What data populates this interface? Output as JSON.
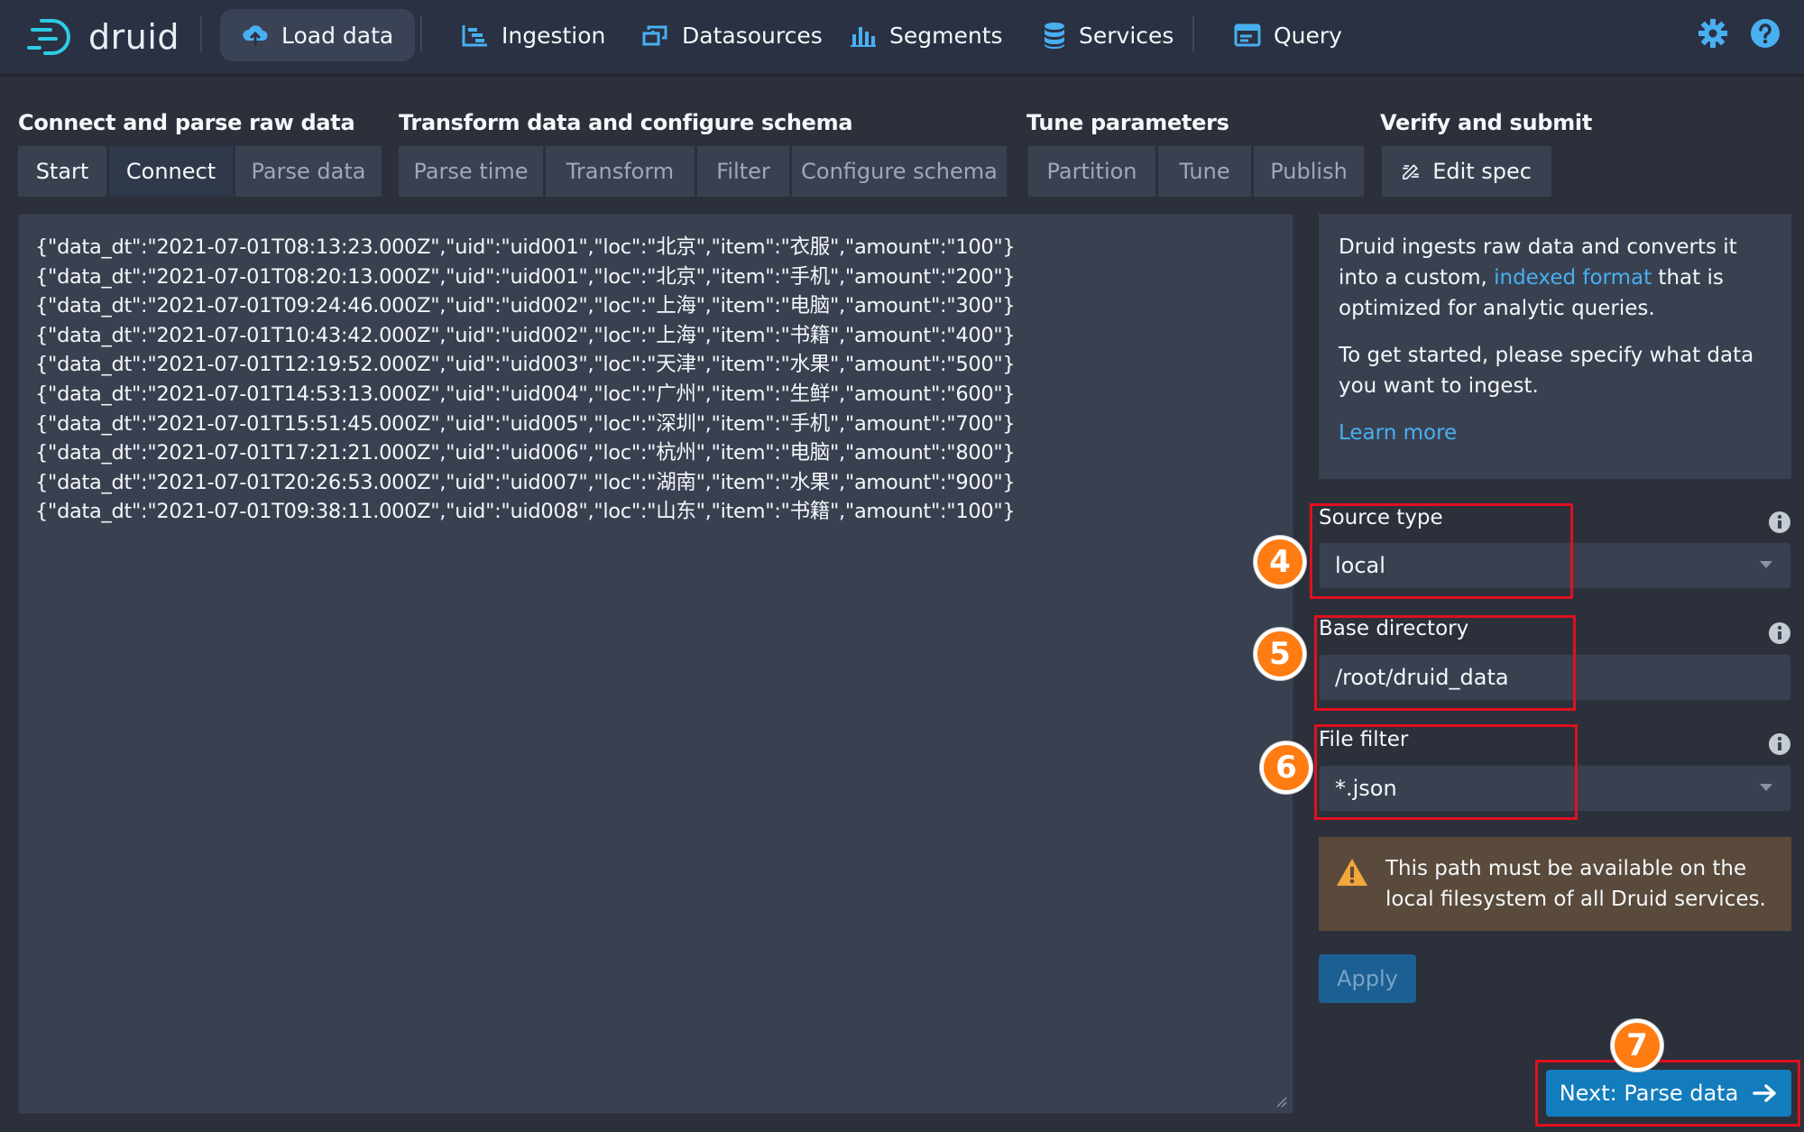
{
  "nav": {
    "logo_text": "druid",
    "items": [
      {
        "label": "Load data",
        "icon": "cloud-upload-icon"
      },
      {
        "label": "Ingestion",
        "icon": "gantt-chart-icon"
      },
      {
        "label": "Datasources",
        "icon": "multi-select-icon"
      },
      {
        "label": "Segments",
        "icon": "stacked-chart-icon"
      },
      {
        "label": "Services",
        "icon": "database-icon"
      },
      {
        "label": "Query",
        "icon": "application-icon"
      }
    ],
    "right_icons": [
      "gear-icon",
      "help-icon"
    ],
    "accent": "#48aff0"
  },
  "steps": {
    "connect_header": "Connect and parse raw data",
    "transform_header": "Transform data and configure schema",
    "tune_header": "Tune parameters",
    "verify_header": "Verify and submit",
    "start": "Start",
    "connect": "Connect",
    "parse_data": "Parse data",
    "parse_time": "Parse time",
    "transform": "Transform",
    "filter": "Filter",
    "configure_schema": "Configure schema",
    "partition": "Partition",
    "tune": "Tune",
    "publish": "Publish",
    "edit_spec": "Edit spec"
  },
  "raw_data": [
    "{\"data_dt\":\"2021-07-01T08:13:23.000Z\",\"uid\":\"uid001\",\"loc\":\"北京\",\"item\":\"衣服\",\"amount\":\"100\"}",
    "{\"data_dt\":\"2021-07-01T08:20:13.000Z\",\"uid\":\"uid001\",\"loc\":\"北京\",\"item\":\"手机\",\"amount\":\"200\"}",
    "{\"data_dt\":\"2021-07-01T09:24:46.000Z\",\"uid\":\"uid002\",\"loc\":\"上海\",\"item\":\"电脑\",\"amount\":\"300\"}",
    "{\"data_dt\":\"2021-07-01T10:43:42.000Z\",\"uid\":\"uid002\",\"loc\":\"上海\",\"item\":\"书籍\",\"amount\":\"400\"}",
    "{\"data_dt\":\"2021-07-01T12:19:52.000Z\",\"uid\":\"uid003\",\"loc\":\"天津\",\"item\":\"水果\",\"amount\":\"500\"}",
    "{\"data_dt\":\"2021-07-01T14:53:13.000Z\",\"uid\":\"uid004\",\"loc\":\"广州\",\"item\":\"生鲜\",\"amount\":\"600\"}",
    "{\"data_dt\":\"2021-07-01T15:51:45.000Z\",\"uid\":\"uid005\",\"loc\":\"深圳\",\"item\":\"手机\",\"amount\":\"700\"}",
    "{\"data_dt\":\"2021-07-01T17:21:21.000Z\",\"uid\":\"uid006\",\"loc\":\"杭州\",\"item\":\"电脑\",\"amount\":\"800\"}",
    "{\"data_dt\":\"2021-07-01T20:26:53.000Z\",\"uid\":\"uid007\",\"loc\":\"湖南\",\"item\":\"水果\",\"amount\":\"900\"}",
    "{\"data_dt\":\"2021-07-01T09:38:11.000Z\",\"uid\":\"uid008\",\"loc\":\"山东\",\"item\":\"书籍\",\"amount\":\"100\"}"
  ],
  "info": {
    "p1_before": "Druid ingests raw data and converts it into a custom, ",
    "p1_link": "indexed format",
    "p1_after": " that is optimized for analytic queries.",
    "p2": "To get started, please specify what data you want to ingest.",
    "learn_more": "Learn more"
  },
  "form": {
    "source_type_label": "Source type",
    "source_type_value": "local",
    "base_directory_label": "Base directory",
    "base_directory_value": "/root/druid_data",
    "file_filter_label": "File filter",
    "file_filter_value": "*.json"
  },
  "warning": "This path must be available on the local filesystem of all Druid services.",
  "apply_label": "Apply",
  "next_label": "Next: Parse data",
  "markers": [
    "4",
    "5",
    "6",
    "7"
  ],
  "colors": {
    "background": "#2b303b",
    "panel": "#394151",
    "primary": "#137cbd",
    "warning_bg": "#5a4a3b",
    "marker": "#ff7c13",
    "annotation": "#e0101e"
  }
}
